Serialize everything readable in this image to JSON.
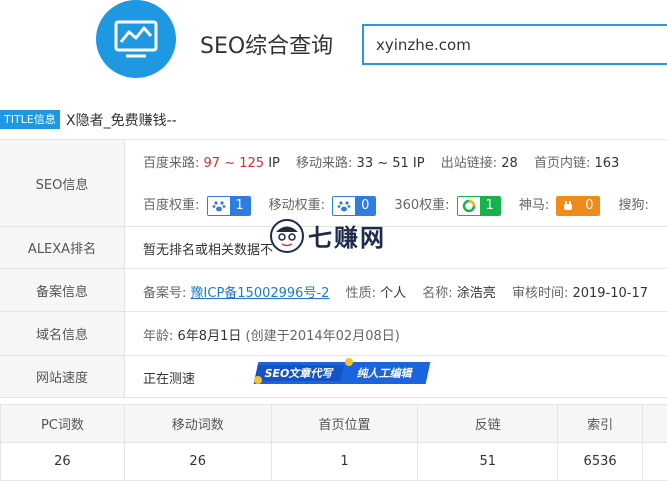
{
  "header": {
    "title": "SEO综合查询",
    "search_value": "xyinzhe.com"
  },
  "site_title": {
    "tag": "TITLE信息",
    "text": "X隐者_免费赚钱--"
  },
  "seo_info": {
    "label": "SEO信息",
    "baidu_source_label": "百度来路:",
    "baidu_source_value": "97 ~ 125",
    "baidu_source_unit": "IP",
    "mobile_source_label": "移动来路:",
    "mobile_source_value": "33 ~ 51 IP",
    "outbound_label": "出站链接:",
    "outbound_value": "28",
    "homepage_links_label": "首页内链:",
    "homepage_links_value": "163",
    "baidu_weight_label": "百度权重:",
    "baidu_weight_value": "1",
    "mobile_weight_label": "移动权重:",
    "mobile_weight_value": "0",
    "w360_label": "360权重:",
    "w360_value": "1",
    "shenma_label": "神马:",
    "shenma_value": "0",
    "sogou_label": "搜狗:"
  },
  "alexa": {
    "label": "ALEXA排名",
    "value": "暂无排名或相关数据不"
  },
  "beian": {
    "label": "备案信息",
    "number_label": "备案号:",
    "number_value": "豫ICP备15002996号-2",
    "nature_label": "性质:",
    "nature_value": "个人",
    "name_label": "名称:",
    "name_value": "涂浩亮",
    "review_label": "审核时间:",
    "review_value": "2019-10-17"
  },
  "domain": {
    "label": "域名信息",
    "age_label": "年龄:",
    "age_value": "6年8月1日",
    "created": "(创建于2014年02月08日)"
  },
  "speed": {
    "label": "网站速度",
    "value": "正在测速"
  },
  "banner": {
    "left": "SEO文章代写",
    "right": "纯人工编辑"
  },
  "watermark": {
    "text": "七赚网"
  },
  "stats": {
    "headers": [
      "PC词数",
      "移动词数",
      "首页位置",
      "反链",
      "索引",
      ""
    ],
    "values": [
      "26",
      "26",
      "1",
      "51",
      "6536",
      ""
    ]
  },
  "colors": {
    "brand_blue": "#1e98e0",
    "badge_blue": "#2f7de1",
    "badge_green": "#17b24a",
    "badge_orange": "#f08a1a",
    "accent_red": "#e0292a",
    "link_blue": "#1b7bc6"
  },
  "icons": {
    "logo": "chart-monitor-icon",
    "baidu": "paw-icon",
    "360": "ring-icon",
    "shenma": "horse-icon"
  }
}
